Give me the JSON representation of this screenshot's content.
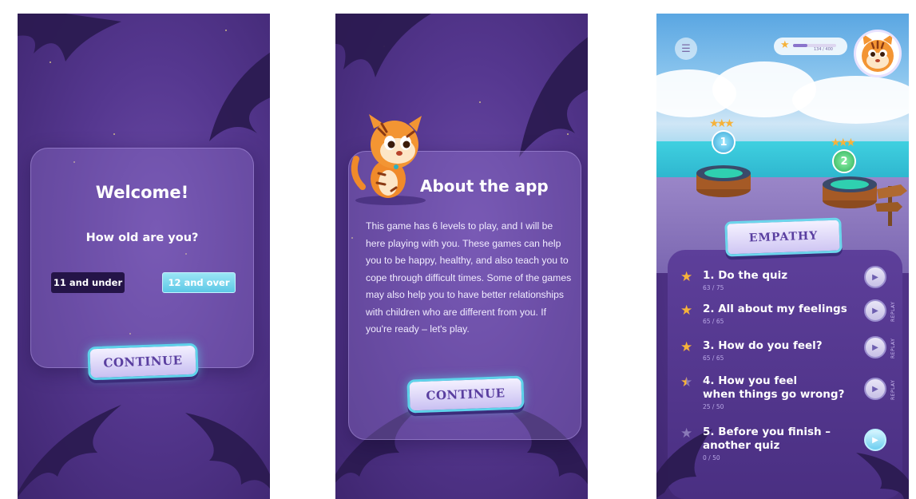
{
  "welcome_screen": {
    "title": "Welcome!",
    "question": "How old are you?",
    "age_options": [
      "11 and under",
      "12 and over"
    ],
    "selected_age": "12 and over",
    "continue_label": "CONTINUE"
  },
  "about_screen": {
    "title": "About the app",
    "body": "This game has 6 levels to play, and I will be here playing with you. These games can help you to be happy, healthy, and also teach you to cope through difficult times. Some of the games may also help you to have better relationships with children who are different from you. If you're ready – let's play.",
    "continue_label": "CONTINUE"
  },
  "levels_screen": {
    "progress": {
      "current": 134,
      "total": 400,
      "text": "134 / 400"
    },
    "level_badges": [
      "1",
      "2"
    ],
    "category": "EMPATHY",
    "levels": [
      {
        "title": "1. Do the quiz",
        "score": "63 / 75",
        "star": "full",
        "replay": ""
      },
      {
        "title": "2. All about my feelings",
        "score": "65 / 65",
        "star": "full",
        "replay": "REPLAY"
      },
      {
        "title": "3. How do you feel?",
        "score": "65 / 65",
        "star": "full",
        "replay": "REPLAY"
      },
      {
        "title_line1": "4. How you feel",
        "title_line2": "when things go wrong?",
        "score": "25 / 50",
        "star": "half",
        "replay": "REPLAY"
      },
      {
        "title_line1": "5. Before you finish –",
        "title_line2": "another quiz",
        "score": "0 / 50",
        "star": "empty",
        "replay": ""
      }
    ]
  },
  "colors": {
    "background_purple": "#55378f",
    "accent_cyan": "#5ed3ea",
    "star_gold": "#f6b23a",
    "button_text": "#5a3fa0"
  }
}
